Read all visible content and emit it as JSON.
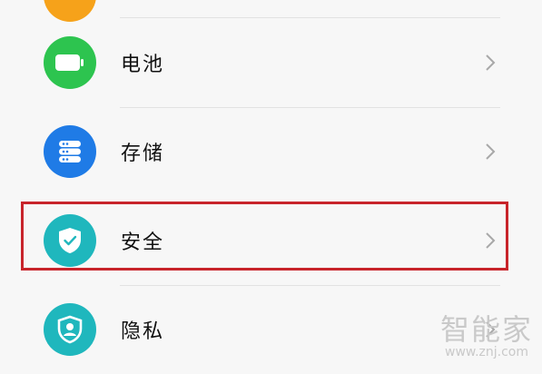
{
  "settings": {
    "items": [
      {
        "label": "电池",
        "icon": "battery-icon",
        "color": "#2dc44f"
      },
      {
        "label": "存储",
        "icon": "storage-icon",
        "color": "#1f7be6"
      },
      {
        "label": "安全",
        "icon": "shield-check-icon",
        "color": "#1fb7bd"
      },
      {
        "label": "隐私",
        "icon": "privacy-icon",
        "color": "#1fb7bd"
      }
    ]
  },
  "highlight": {
    "target": "安全",
    "color": "#c8242b"
  },
  "watermark": {
    "name": "智能家",
    "url": "www.znj.com"
  }
}
